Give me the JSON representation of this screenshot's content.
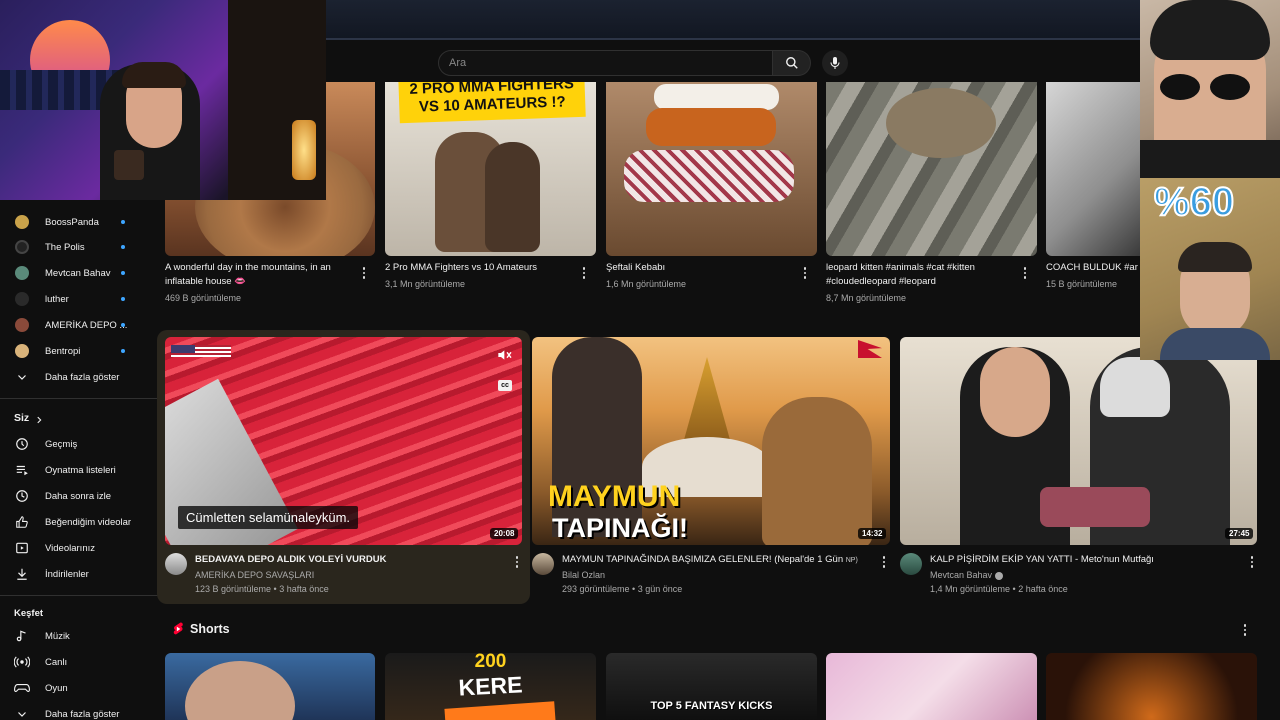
{
  "search": {
    "placeholder": "Ara"
  },
  "icons": {
    "search": "search-icon",
    "mic": "mic-icon",
    "more": "more-vert-icon",
    "chevron": "chevron-right-icon",
    "shorts": "shorts-icon",
    "mute": "mute-icon",
    "cc": "closed-captions-icon"
  },
  "colors": {
    "accent": "#3ea6ff",
    "background": "#0f0f0f",
    "shorts_red": "#ff0033"
  },
  "sidebar": {
    "subscriptions": [
      {
        "label": "BoossPanda"
      },
      {
        "label": "The Polis"
      },
      {
        "label": "Mevtcan Bahav"
      },
      {
        "label": "luther"
      },
      {
        "label": "AMERİKA DEPO ..."
      },
      {
        "label": "Bentropi"
      }
    ],
    "show_more": "Daha fazla göster",
    "you_header": "Siz",
    "you_items": [
      {
        "label": "Geçmiş"
      },
      {
        "label": "Oynatma listeleri"
      },
      {
        "label": "Daha sonra izle"
      },
      {
        "label": "Beğendiğim videolar"
      },
      {
        "label": "Videolarınız"
      },
      {
        "label": "İndirilenler"
      }
    ],
    "explore_header": "Keşfet",
    "explore_items": [
      {
        "label": "Müzik"
      },
      {
        "label": "Canlı"
      },
      {
        "label": "Oyun"
      }
    ],
    "show_more_2": "Daha fazla göster"
  },
  "row1": [
    {
      "title": "A wonderful day in the mountains, in an inflatable house 👄",
      "meta": "469 B görüntüleme"
    },
    {
      "title": "2 Pro MMA Fighters vs 10 Amateurs",
      "meta": "3,1 Mn görüntüleme",
      "thumb_text": "2 PRO MMA FIGHTERS VS 10 AMATEURS !?"
    },
    {
      "title": "Şeftali Kebabı",
      "meta": "1,6 Mn görüntüleme"
    },
    {
      "title": "leopard kitten #animals #cat #kitten #cloudedleopard #leopard",
      "meta": "8,7 Mn görüntüleme"
    },
    {
      "title": "COACH BULDUK #ar",
      "meta": "15 B görüntüleme"
    }
  ],
  "row2": [
    {
      "title": "BEDAVAYA DEPO ALDIK VOLEYİ VURDUK",
      "channel": "AMERİKA DEPO SAVAŞLARI",
      "meta": "123 B görüntüleme • 3 hafta önce",
      "duration": "20:08",
      "caption": "Cümletten selamünaleyküm."
    },
    {
      "title": "MAYMUN TAPINAĞINDA BAŞIMIZA GELENLER! (Nepal'de 1 Gün",
      "badge": "NP)",
      "channel": "Bilal Ozlan",
      "meta": "293 görüntüleme • 3 gün önce",
      "duration": "14:32",
      "thumb_text_1": "MAYMUN",
      "thumb_text_2": "TAPINAĞI!"
    },
    {
      "title": "KALP PİŞİRDİM EKİP YAN YATTI - Meto'nun Mutfağı",
      "channel": "Mevtcan Bahav",
      "meta": "1,4 Mn görüntüleme • 2 hafta önce",
      "duration": "27:45"
    }
  ],
  "overlay": {
    "percent": "%60"
  },
  "shorts": {
    "title": "Shorts",
    "thumb_texts": [
      "200",
      "KERE",
      "TOP 5 FANTASY KICKS"
    ]
  }
}
